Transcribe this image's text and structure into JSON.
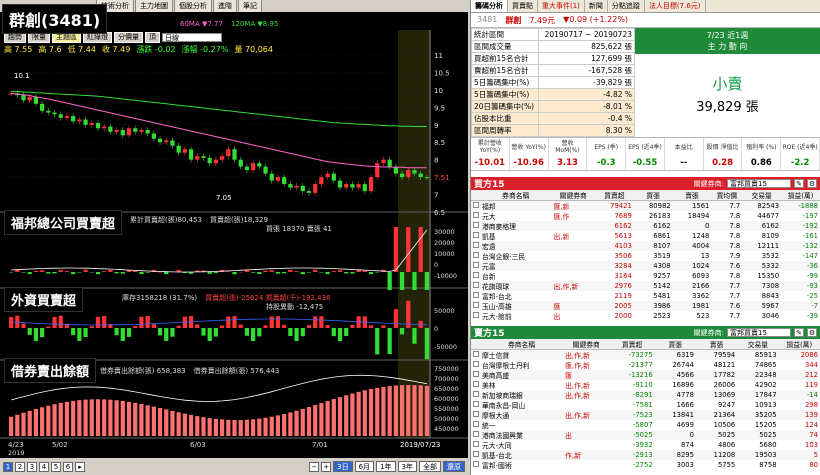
{
  "left": {
    "tabs": [
      "技術分析",
      "主力地圖",
      "個股分析",
      "進階",
      "筆記"
    ],
    "stock_title": "群創(3481)",
    "legend_top": [
      {
        "label": "60MA ▼7.77",
        "color": "#ff66cc"
      },
      {
        "label": "120MA ▼8.95",
        "color": "#33dd33"
      }
    ],
    "toolbar": {
      "buttons": [
        "趨勢",
        "限量",
        "主題區",
        "紅綠燈",
        "分價量",
        "頂"
      ],
      "active": "主題區",
      "period": "日線"
    },
    "quote": {
      "high": "高 7.55",
      "low": "高 7.6",
      "prev": "低 7.44",
      "close": "收 7.49",
      "chg": "漲跌 -0.02",
      "pct": "漲幅 -0.27%",
      "vol": "量 70,064"
    },
    "price_axis": [
      "11",
      "10.5",
      "10",
      "9.5",
      "9",
      "8.5",
      "8",
      "7.51",
      "7",
      "6.5"
    ],
    "price_annotations": {
      "high": "10.1",
      "low": "7.05"
    },
    "price_series": [
      9.9,
      9.85,
      9.7,
      9.8,
      9.6,
      9.4,
      9.35,
      9.3,
      9.2,
      9.25,
      9.1,
      9.15,
      9.0,
      9.05,
      8.9,
      8.95,
      8.8,
      8.85,
      8.7,
      8.9,
      8.8,
      8.85,
      8.75,
      8.6,
      8.5,
      8.55,
      8.4,
      8.2,
      8.3,
      8.0,
      8.1,
      8.05,
      7.9,
      8.0,
      8.1,
      8.3,
      8.0,
      7.8,
      7.7,
      7.9,
      7.8,
      7.6,
      7.4,
      7.5,
      7.3,
      7.2,
      7.25,
      7.1,
      7.05,
      7.3,
      7.5,
      7.6,
      7.4,
      7.2,
      7.3,
      7.2,
      7.3,
      7.1,
      7.5,
      7.9,
      8.0,
      7.8,
      7.6,
      7.5,
      7.7,
      7.6,
      7.5,
      7.49
    ],
    "ma60": [
      9.9,
      9.88,
      9.86,
      9.84,
      9.8,
      9.77,
      9.74,
      9.7,
      9.66,
      9.62,
      9.58,
      9.54,
      9.5,
      9.46,
      9.42,
      9.38,
      9.34,
      9.3,
      9.26,
      9.22,
      9.18,
      9.14,
      9.1,
      9.06,
      9.02,
      8.98,
      8.94,
      8.9,
      8.86,
      8.82,
      8.78,
      8.74,
      8.7,
      8.66,
      8.62,
      8.58,
      8.54,
      8.5,
      8.46,
      8.42,
      8.38,
      8.34,
      8.3,
      8.26,
      8.22,
      8.18,
      8.14,
      8.1,
      8.06,
      8.02,
      7.98,
      7.94,
      7.92,
      7.9,
      7.88,
      7.86,
      7.84,
      7.82,
      7.81,
      7.8,
      7.79,
      7.79,
      7.78,
      7.78,
      7.77,
      7.77,
      7.77,
      7.77
    ],
    "ma120": [
      9.95,
      9.95,
      9.94,
      9.93,
      9.92,
      9.91,
      9.9,
      9.89,
      9.88,
      9.87,
      9.86,
      9.85,
      9.84,
      9.83,
      9.82,
      9.8,
      9.78,
      9.76,
      9.74,
      9.72,
      9.7,
      9.68,
      9.66,
      9.64,
      9.62,
      9.6,
      9.58,
      9.56,
      9.54,
      9.52,
      9.5,
      9.48,
      9.46,
      9.44,
      9.42,
      9.4,
      9.38,
      9.36,
      9.34,
      9.32,
      9.3,
      9.28,
      9.26,
      9.24,
      9.22,
      9.2,
      9.18,
      9.16,
      9.14,
      9.12,
      9.1,
      9.08,
      9.06,
      9.05,
      9.04,
      9.03,
      9.02,
      9.01,
      9.0,
      8.99,
      8.98,
      8.97,
      8.97,
      8.96,
      8.96,
      8.95,
      8.95,
      8.95
    ],
    "panel2": {
      "overlay": "福邦總公司買賣超",
      "legend": "累計買賣超(張)80,453",
      "legend2": "買賣超(張)18,329",
      "legend3": "買張 18370  賣張 41",
      "axis": [
        "30000",
        "20000",
        "10000",
        "0",
        "-10000"
      ]
    },
    "panel3": {
      "overlay": "外資買賣超",
      "legend": "庫存3158218 (31.7%)",
      "legend2": "買賣超(張)-25624  買賣超(千)-192,436",
      "legend3": "持股異動 -12,475",
      "axis": [
        "50000",
        "0",
        "-50000"
      ]
    },
    "panel4": {
      "overlay": "借券賣出餘額",
      "legend": "借券賣出餘額(張) 658,383",
      "legend2": "借券賣出餘額(張) 576,443",
      "axis": [
        "750000",
        "700000",
        "650000",
        "600000",
        "550000",
        "500000",
        "450000"
      ]
    },
    "x_axis": [
      "4/23",
      "5/02",
      "6/03",
      "7/01",
      "2019/07/23"
    ],
    "x_year": "2019",
    "pages": [
      "1",
      "2",
      "3",
      "4",
      "5",
      "6"
    ],
    "zoom": [
      "3日",
      "6月",
      "1年",
      "3年",
      "全部",
      "還原"
    ],
    "zoom_active": "3日"
  },
  "right": {
    "tabs": [
      "籌碼分析",
      "買賣點",
      "重大事件(1)",
      "新聞",
      "分點追蹤",
      "法人目標(7.6元)"
    ],
    "stock": {
      "code": "3481",
      "name": "群創",
      "price": "7.49元",
      "chg": "▼0.09 (+1.22%)"
    },
    "summary": [
      {
        "label": "統計區間",
        "value": "20190717 ~ 20190723"
      },
      {
        "label": "區間成交量",
        "value": "825,622 張"
      },
      {
        "label": "買超前15名合計",
        "value": "127,699 張"
      },
      {
        "label": "賣超前15名合計",
        "value": "-167,528 張"
      },
      {
        "label": "5日籌碼集中(%)",
        "value": "-39,829 張"
      },
      {
        "label": "5日籌碼集中(%)",
        "value": "-4.82 %"
      },
      {
        "label": "20日籌碼集中(%)",
        "value": "-8.01 %"
      },
      {
        "label": "佔股本比重",
        "value": "-0.4 %"
      },
      {
        "label": "區間周轉率",
        "value": "8.30 %"
      }
    ],
    "trend": {
      "head1": "7/23 近1週",
      "head2": "主 力 動 向",
      "status": "小賣",
      "volume": "39,829 張"
    },
    "financial": [
      {
        "h": "累計營收 YoY(%)",
        "v": "-10.01",
        "c": "#c00"
      },
      {
        "h": "營收 YoY(%)",
        "v": "-10.96",
        "c": "#c00"
      },
      {
        "h": "營收 MoM(%)",
        "v": "3.13",
        "c": "#c00"
      },
      {
        "h": "EPS (季)",
        "v": "-0.3",
        "c": "#080"
      },
      {
        "h": "EPS (近4季)",
        "v": "-0.55",
        "c": "#080"
      },
      {
        "h": "本益比",
        "v": "--",
        "c": "#000"
      },
      {
        "h": "股價 淨值比",
        "v": "0.28",
        "c": "#c00"
      },
      {
        "h": "殖利率 (%)",
        "v": "0.86",
        "c": "#000"
      },
      {
        "h": "ROE (近4季)",
        "v": "-2.2",
        "c": "#080"
      }
    ],
    "buy": {
      "title": "買方15",
      "select_label": "關鍵券商:",
      "select_value": "富邦買賣15",
      "cols": [
        "券商名稱",
        "關鍵券商",
        "買賣超",
        "買張",
        "賣張",
        "買均價",
        "交易量",
        "損益(萬)"
      ],
      "rows": [
        [
          "福邦",
          "匯,新",
          "79421",
          "80982",
          "1561",
          "7.7",
          "82543",
          "-1888"
        ],
        [
          "元大",
          "匯,作",
          "7689",
          "26183",
          "18494",
          "7.8",
          "44677",
          "-197"
        ],
        [
          "港商麥格理",
          "",
          "6162",
          "6162",
          "0",
          "7.8",
          "6162",
          "-192"
        ],
        [
          "凱基",
          "出,新",
          "5613",
          "6861",
          "1248",
          "7.8",
          "8109",
          "-161"
        ],
        [
          "宏遠",
          "",
          "4103",
          "8107",
          "4004",
          "7.8",
          "12111",
          "-132"
        ],
        [
          "台灣企銀-三民",
          "",
          "3506",
          "3519",
          "13",
          "7.9",
          "3532",
          "-147"
        ],
        [
          "元富",
          "",
          "3284",
          "4308",
          "1024",
          "7.6",
          "5332",
          "-36"
        ],
        [
          "台新",
          "",
          "3164",
          "9257",
          "6093",
          "7.8",
          "15350",
          "-99"
        ],
        [
          "花旗環球",
          "出,作,新",
          "2976",
          "5142",
          "2166",
          "7.7",
          "7308",
          "-93"
        ],
        [
          "富邦-台北",
          "",
          "2119",
          "5481",
          "3362",
          "7.7",
          "8843",
          "-25"
        ],
        [
          "玉山-高雄",
          "匯",
          "2005",
          "3986",
          "1981",
          "7.6",
          "5967",
          "-7"
        ],
        [
          "元大-館前",
          "出",
          "2000",
          "2523",
          "523",
          "7.7",
          "3046",
          "-39"
        ]
      ]
    },
    "sell": {
      "title": "賣方15",
      "select_label": "關鍵券商:",
      "select_value": "富邦買賣15",
      "cols": [
        "券商名稱",
        "關鍵券商",
        "買賣超",
        "買張",
        "賣張",
        "交易量",
        "損益(萬)"
      ],
      "rows": [
        [
          "摩士信貸",
          "出,作,新",
          "-73275",
          "6319",
          "79594",
          "85913",
          "2086"
        ],
        [
          "台灣摩根士丹利",
          "匯,作,新",
          "-21377",
          "26744",
          "48121",
          "74865",
          "344"
        ],
        [
          "美商高盛",
          "匯",
          "-13216",
          "4566",
          "17782",
          "22348",
          "212"
        ],
        [
          "美林",
          "出,作,新",
          "-9110",
          "16896",
          "26006",
          "42902",
          "119"
        ],
        [
          "新加坡商瑞銀",
          "出,作,新",
          "-8291",
          "4778",
          "13069",
          "17847",
          "-14"
        ],
        [
          "華南永昌-岡山",
          "",
          "-7581",
          "1666",
          "9247",
          "10913",
          "298"
        ],
        [
          "摩根大通",
          "出,作,新",
          "-7523",
          "13841",
          "21364",
          "35205",
          "139"
        ],
        [
          "統一",
          "",
          "-5807",
          "4699",
          "10506",
          "15205",
          "124"
        ],
        [
          "港商法國興業",
          "出",
          "-5025",
          "0",
          "5025",
          "5025",
          "74"
        ],
        [
          "元大-大同",
          "",
          "-3932",
          "874",
          "4806",
          "5680",
          "103"
        ],
        [
          "凱基-台北",
          "作,新",
          "-2913",
          "8295",
          "11208",
          "19503",
          "5"
        ],
        [
          "富邦-國術",
          "",
          "-2752",
          "3003",
          "5755",
          "8758",
          "80"
        ]
      ]
    }
  },
  "colors": {
    "buy_header": "#d9202b",
    "sell_header": "#1f8a3a",
    "bg_chart": "#000000"
  }
}
